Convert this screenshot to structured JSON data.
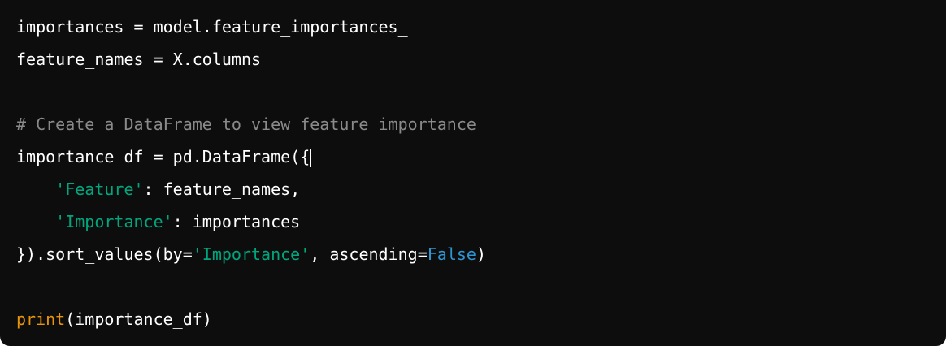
{
  "code": {
    "line1": "importances = model.feature_importances_",
    "line2": "feature_names = X.columns",
    "line4_comment": "# Create a DataFrame to view feature importance",
    "line5": "importance_df = pd.DataFrame({",
    "line6_indent": "    ",
    "line6_string": "'Feature'",
    "line6_rest": ": feature_names,",
    "line7_indent": "    ",
    "line7_string": "'Importance'",
    "line7_rest": ": importances",
    "line8_start": "}).sort_values(by=",
    "line8_string": "'Importance'",
    "line8_mid": ", ascending=",
    "line8_bool": "False",
    "line8_end": ")",
    "line10_builtin": "print",
    "line10_rest": "(importance_df)"
  },
  "colors": {
    "background": "#0d0d0d",
    "text": "#ffffff",
    "comment": "#8a8a8a",
    "string": "#00a67d",
    "boolean": "#2e95d3",
    "builtin": "#e9950c"
  }
}
